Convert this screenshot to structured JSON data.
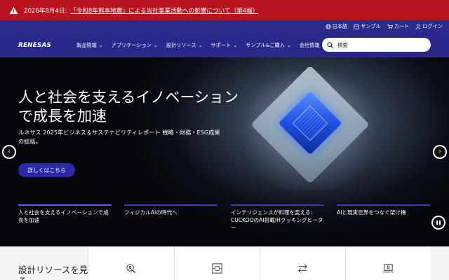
{
  "alert": {
    "date": "2026年8月4日:",
    "link": "「令和8年熊本地震」による当社事業活動への影響について（第4報）",
    "icon": "warning-icon",
    "bg_color": "#b8141f"
  },
  "utility": {
    "language": "日本語",
    "sample": "サンプル",
    "cart": "カート",
    "login": "ログイン"
  },
  "nav": {
    "logo": "RENESAS",
    "items": [
      "製品情報",
      "アプリケーション",
      "設計リソース",
      "サポート",
      "サンプル&ご購入",
      "会社情報"
    ],
    "search_placeholder": "検索",
    "bg_color": "#29288a"
  },
  "hero": {
    "title": "人と社会を支えるイノベーションで成長を加速",
    "subtitle": "ルネサス 2025年ビジネス＆サステナビリティレポート 戦略・財務・ESG成果の総括。",
    "button": "詳しくはこちら",
    "slides": [
      "人と社会を支えるイノベーションで成長を加速",
      "フィジカルAIの時代へ",
      "インテリジェンスが料理を変える：CUCKOOのAI搭載IHクッキングヒーター",
      "AIと現実世界をつなぐ架け橋"
    ],
    "active_slide": 0,
    "accent_color": "#2b2aa6"
  },
  "bottom": {
    "title": "設計リソースを見る",
    "cards": [
      {
        "icon": "search-people-icon"
      },
      {
        "icon": "board-icon"
      },
      {
        "icon": "swap-arrows-icon"
      },
      {
        "icon": "laptop-user-icon"
      }
    ]
  }
}
